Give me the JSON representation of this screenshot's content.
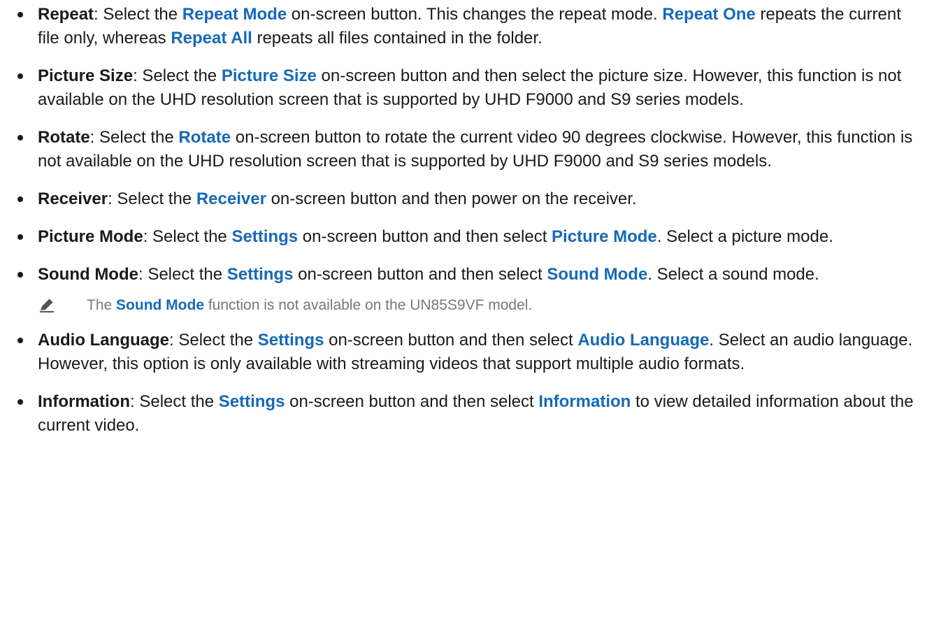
{
  "items": [
    {
      "term": "Repeat",
      "parts": [
        {
          "t": ": Select the "
        },
        {
          "t": "Repeat Mode",
          "ui": true
        },
        {
          "t": " on-screen button. This changes the repeat mode. "
        },
        {
          "t": "Repeat One",
          "ui": true
        },
        {
          "t": " repeats the current file only, whereas "
        },
        {
          "t": "Repeat All",
          "ui": true
        },
        {
          "t": " repeats all files contained in the folder."
        }
      ]
    },
    {
      "term": "Picture Size",
      "parts": [
        {
          "t": ": Select the "
        },
        {
          "t": "Picture Size",
          "ui": true
        },
        {
          "t": " on-screen button and then select the picture size. However, this function is not available on the UHD resolution screen that is supported by UHD F9000 and S9 series models."
        }
      ]
    },
    {
      "term": "Rotate",
      "parts": [
        {
          "t": ": Select the "
        },
        {
          "t": "Rotate",
          "ui": true
        },
        {
          "t": " on-screen button to rotate the current video 90 degrees clockwise. However, this function is not available on the UHD resolution screen that is supported by UHD F9000 and S9 series models."
        }
      ]
    },
    {
      "term": "Receiver",
      "parts": [
        {
          "t": ": Select the "
        },
        {
          "t": "Receiver",
          "ui": true
        },
        {
          "t": " on-screen button and then power on the receiver."
        }
      ]
    },
    {
      "term": "Picture Mode",
      "parts": [
        {
          "t": ": Select the "
        },
        {
          "t": "Settings",
          "ui": true
        },
        {
          "t": " on-screen button and then select "
        },
        {
          "t": "Picture Mode",
          "ui": true
        },
        {
          "t": ". Select a picture mode."
        }
      ]
    },
    {
      "term": "Sound Mode",
      "parts": [
        {
          "t": ": Select the "
        },
        {
          "t": "Settings",
          "ui": true
        },
        {
          "t": " on-screen button and then select "
        },
        {
          "t": "Sound Mode",
          "ui": true
        },
        {
          "t": ". Select a sound mode."
        }
      ],
      "note": {
        "icon": "pencil-icon",
        "parts": [
          {
            "t": "The "
          },
          {
            "t": "Sound Mode",
            "ui": true
          },
          {
            "t": " function is not available on the UN85S9VF model."
          }
        ]
      }
    },
    {
      "term": "Audio Language",
      "parts": [
        {
          "t": ": Select the "
        },
        {
          "t": "Settings",
          "ui": true
        },
        {
          "t": " on-screen button and then select "
        },
        {
          "t": "Audio Language",
          "ui": true
        },
        {
          "t": ". Select an audio language. However, this option is only available with streaming videos that support multiple audio formats."
        }
      ]
    },
    {
      "term": "Information",
      "parts": [
        {
          "t": ": Select the "
        },
        {
          "t": "Settings",
          "ui": true
        },
        {
          "t": " on-screen button and then select "
        },
        {
          "t": "Information",
          "ui": true
        },
        {
          "t": " to view detailed information about the current video."
        }
      ]
    }
  ],
  "colors": {
    "text": "#1a1a1a",
    "ui_term": "#1769b6",
    "note_text": "#777777"
  }
}
